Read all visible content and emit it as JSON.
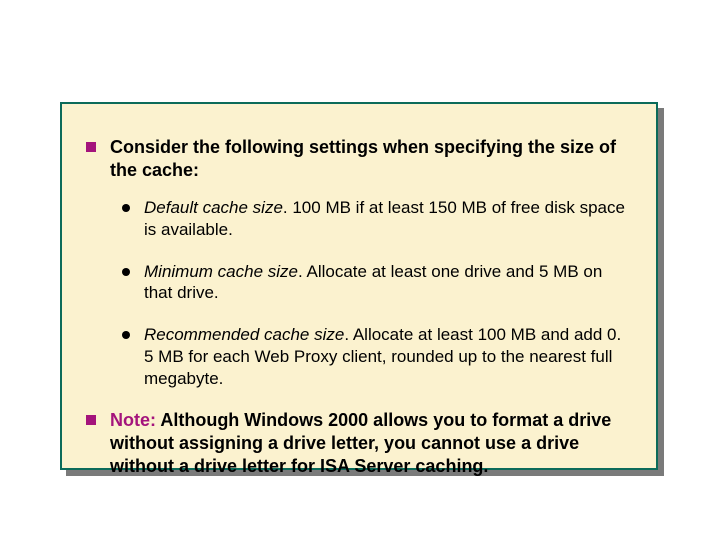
{
  "main": {
    "heading": "Consider the following settings when specifying the size of the cache:",
    "items": [
      {
        "lead": "Default cache size",
        "rest": ". 100 MB if at least 150 MB of free disk space is available."
      },
      {
        "lead": "Minimum cache size",
        "rest": ". Allocate at least one drive and 5 MB on that drive."
      },
      {
        "lead": "Recommended cache size",
        "rest": ". Allocate at least 100 MB and add 0. 5 MB for each Web Proxy client, rounded up to the nearest full megabyte."
      }
    ],
    "note_label": "Note:",
    "note_body": " Although Windows 2000 allows you to format a drive without assigning a drive letter, you cannot use a drive without a drive letter for ISA Server caching."
  }
}
